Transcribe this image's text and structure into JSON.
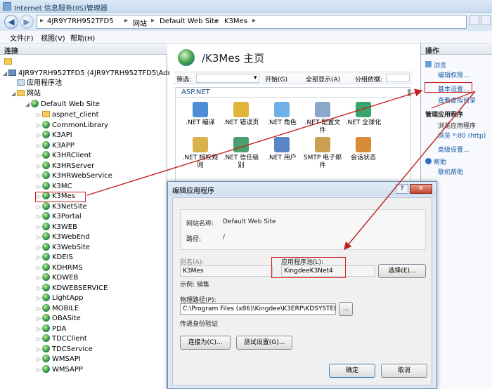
{
  "window": {
    "title": "Internet 信息服务(IIS)管理器"
  },
  "address": {
    "crumbs": [
      "4JR9Y7RH952TFD5",
      "网站",
      "Default Web Site",
      "K3Mes"
    ]
  },
  "menu": [
    "文件(F)",
    "视图(V)",
    "帮助(H)"
  ],
  "left": {
    "header": "连接",
    "server_node": "4JR9Y7RH952TFD5 (4JR9Y7RH952TFD5\\Adminis",
    "app_pools": "应用程序池",
    "sites": "网站",
    "default_site": "Default Web Site",
    "children": [
      "aspnet_client",
      "CommonLibrary",
      "K3API",
      "K3APP",
      "K3HRClient",
      "K3HRServer",
      "K3HRWebService",
      "K3MC",
      "K3Mes",
      "K3NetSite",
      "K3Portal",
      "K3WEB",
      "K3WebEnd",
      "K3WebSite",
      "KDEIS",
      "KDHRMS",
      "KDWEB",
      "KDWEBSERVICE",
      "LightApp",
      "MOBILE",
      "OBASite",
      "PDA",
      "TDCClient",
      "TDCService",
      "WMSAPI",
      "WMSAPP"
    ]
  },
  "center": {
    "title": "/K3Mes 主页",
    "filter_label": "筛选:",
    "start_label": "开始(G)",
    "showall_label": "全部显示(A)",
    "groupby_label": "分组依据:",
    "group_name": "ASP.NET",
    "features_row1": [
      ".NET 编译",
      ".NET 错误页",
      ".NET 角色",
      ".NET 配置文件",
      ".NET 全球化"
    ],
    "features_row2": [
      ".NET 授权规则",
      ".NET 信任级别",
      ".NET 用户",
      "SMTP 电子邮件",
      "会话状态"
    ]
  },
  "right": {
    "header": "操作",
    "browse": "浏览",
    "edit_perm": "编辑权限...",
    "basic_settings": "基本设置...",
    "view_vdirs": "查看虚拟目录",
    "manage_app": "管理应用程序",
    "browse_app": "浏览应用程序",
    "browse_port": "浏览 *:80 (http)",
    "advanced": "高级设置...",
    "help": "帮助",
    "online_help": "联机帮助"
  },
  "dialog": {
    "title": "编辑应用程序",
    "help_glyph": "?",
    "close_glyph": "✕",
    "site_name_label": "网站名称:",
    "site_name": "Default Web Site",
    "path_label": "路径:",
    "path": "/",
    "alias_label": "别名(A):",
    "alias": "K3Mes",
    "pool_label": "应用程序池(L):",
    "pool": "KingdeeK3Net4",
    "select_button": "选择(E)...",
    "example": "示例: 销售",
    "physical_label": "物理路径(P):",
    "physical_path": "C:\\Program Files (x86)\\Kingdee\\K3ERP\\KDSYSTEM\\",
    "browse_button": "...",
    "pass_auth": "传递身份验证",
    "connect_as": "连接为(C)...",
    "test_settings": "测试设置(G)...",
    "ok": "确定",
    "cancel": "取消"
  },
  "colors": {
    "accent": "#1a5aa8",
    "annotation": "#d31c1c"
  }
}
